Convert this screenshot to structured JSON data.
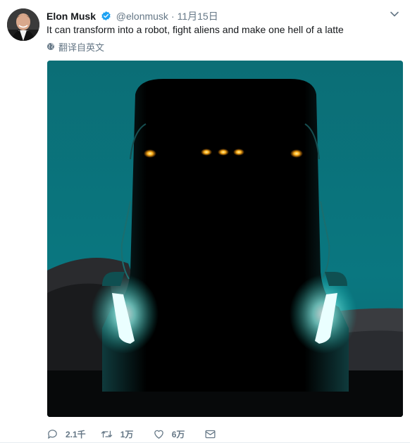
{
  "tweet": {
    "author_name": "Elon Musk",
    "author_handle": "@elonmusk",
    "separator": "·",
    "timestamp": "11月15日",
    "text": "It can transform into a robot, fight aliens and make one hell of a latte",
    "translate_label": "翻译自英文"
  },
  "actions": {
    "reply_count": "2.1千",
    "retweet_count": "1万",
    "like_count": "6万"
  },
  "colors": {
    "verified_blue": "#1da1f2",
    "secondary_text": "#657786",
    "teal_sky": "#06777e"
  },
  "icons": [
    "verified-badge-icon",
    "chevron-down-icon",
    "globe-icon",
    "reply-icon",
    "retweet-icon",
    "like-icon",
    "direct-message-icon"
  ]
}
